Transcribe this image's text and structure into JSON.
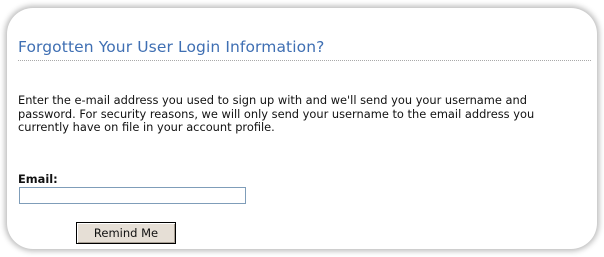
{
  "page": {
    "title": "Forgotten Your User Login Information?",
    "description": "Enter the e-mail address you used to sign up with and we'll send you your username and\npassword.  For security reasons, we will only send your username to the email address you\ncurrently have on file in your account profile.",
    "form": {
      "email_label": "Email:",
      "email_value": "",
      "submit_label": "Remind Me"
    }
  },
  "colors": {
    "title": "#3f6fb3",
    "button_background": "#e6dfd6"
  }
}
